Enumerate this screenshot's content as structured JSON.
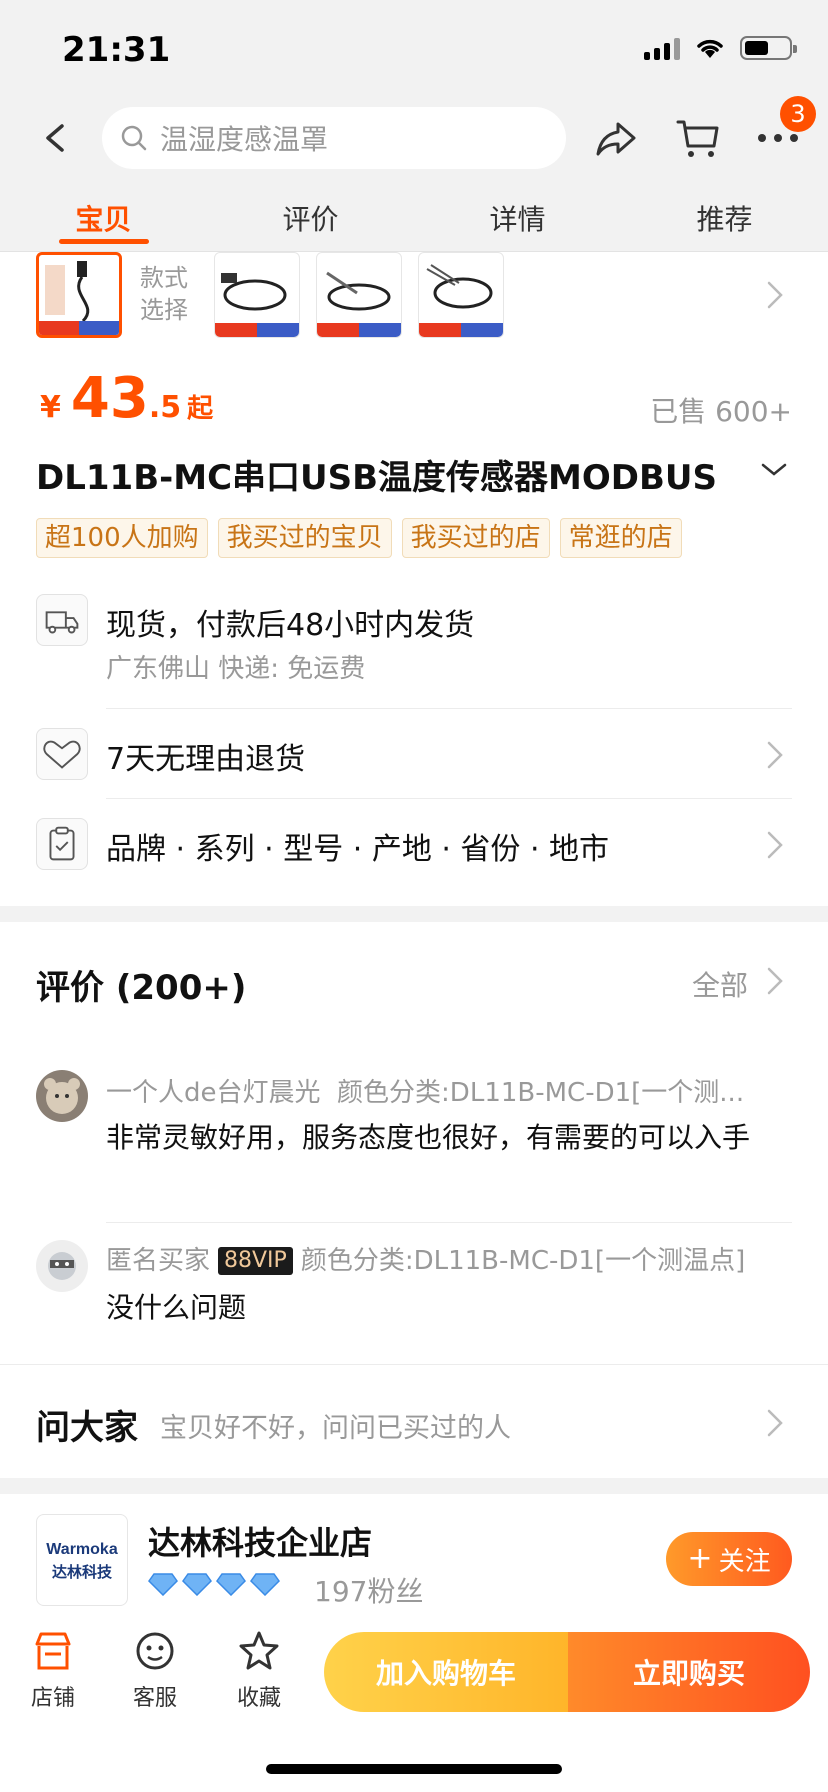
{
  "status_bar": {
    "time": "21:31"
  },
  "header": {
    "search_placeholder": "温湿度感温罩",
    "cart_badge": "3",
    "tabs": [
      {
        "label": "宝贝",
        "active": true
      },
      {
        "label": "评价",
        "active": false
      },
      {
        "label": "详情",
        "active": false
      },
      {
        "label": "推荐",
        "active": false
      }
    ]
  },
  "style_selection": {
    "label": "款式选择"
  },
  "product": {
    "price_currency": "¥",
    "price_integer": "43",
    "price_decimal": ".5",
    "price_suffix": "起",
    "sold": "已售 600+",
    "title": "DL11B-MC串口USB温度传感器MODBUS",
    "tags": [
      "超100人加购",
      "我买过的宝贝",
      "我买过的店",
      "常逛的店"
    ]
  },
  "service": {
    "shipping_main": "现货，付款后48小时内发货",
    "shipping_sub": "广东佛山  快递: 免运费",
    "returns": "7天无理由退货",
    "params": "品牌 · 系列 · 型号 · 产地 · 省份 · 地市"
  },
  "reviews": {
    "title": "评价 (200+)",
    "all_label": "全部",
    "items": [
      {
        "user": "一个人de台灯晨光",
        "variant": "颜色分类:DL11B-MC-D1[一个测...",
        "text": "非常灵敏好用，服务态度也很好，有需要的可以入手"
      },
      {
        "user": "匿名买家",
        "vip": "88VIP",
        "variant": "颜色分类:DL11B-MC-D1[一个测温点]",
        "text": "没什么问题"
      }
    ]
  },
  "ask": {
    "title": "问大家",
    "subtitle": "宝贝好不好，问问已买过的人"
  },
  "shop": {
    "name": "达林科技企业店",
    "logo_text_top": "Warmoka",
    "logo_text_bottom": "达林科技",
    "fans": "197粉丝",
    "follow_label": "关注"
  },
  "bottom_bar": {
    "store_label": "店铺",
    "service_label": "客服",
    "favorite_label": "收藏",
    "add_cart_label": "加入购物车",
    "buy_now_label": "立即购买"
  },
  "colors": {
    "accent": "#ff5000",
    "tag_text": "#c87416",
    "muted": "#999999"
  }
}
